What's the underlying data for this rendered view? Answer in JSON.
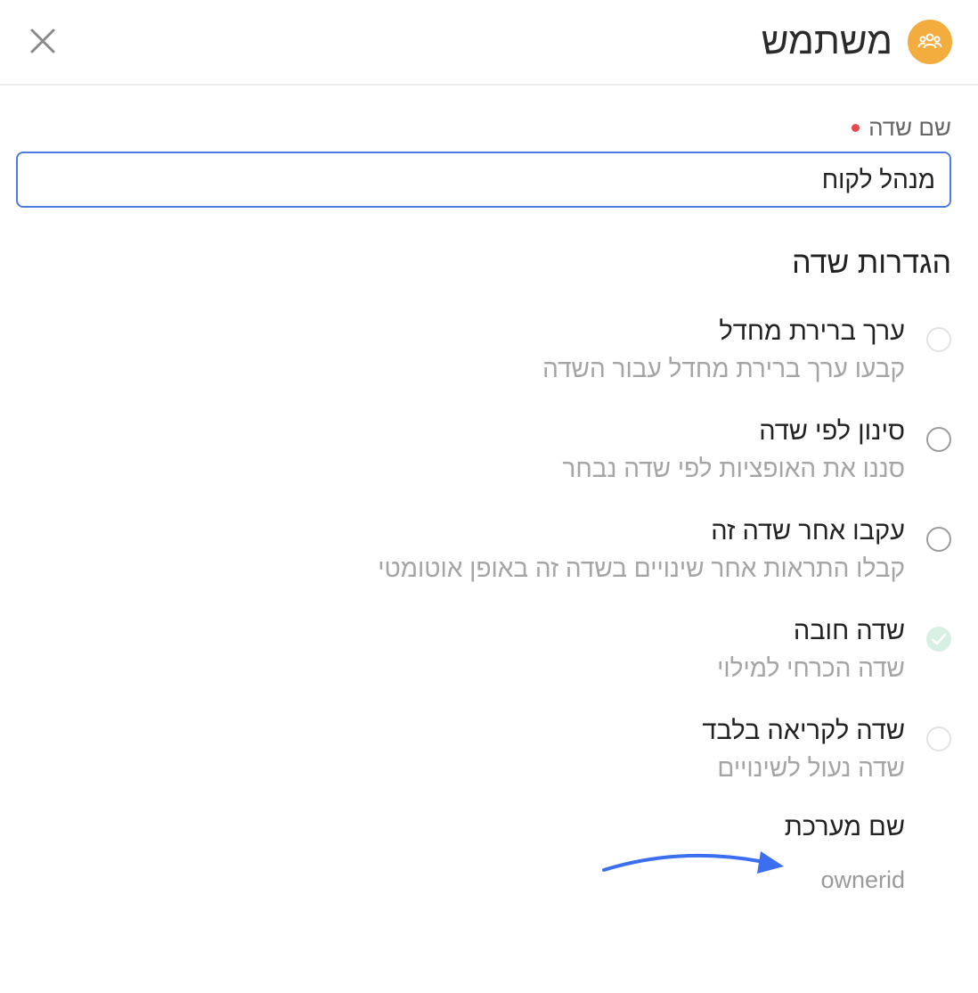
{
  "header": {
    "title": "משתמש",
    "avatar_icon": "users-group-icon",
    "avatar_color": "#f3ad3f",
    "close_icon": "close-icon"
  },
  "field_name": {
    "label": "שם שדה",
    "required": true,
    "value": "מנהל לקוח"
  },
  "settings": {
    "title": "הגדרות שדה",
    "items": [
      {
        "title": "ערך ברירת מחדל",
        "description": "קבעו ערך ברירת מחדל עבור השדה",
        "checked": false
      },
      {
        "title": "סינון לפי שדה",
        "description": "סננו את האופציות לפי שדה נבחר",
        "checked": false
      },
      {
        "title": "עקבו אחר שדה זה",
        "description": "קבלו התראות אחר שינויים בשדה זה באופן אוטומטי",
        "checked": false
      },
      {
        "title": "שדה חובה",
        "description": "שדה הכרחי למילוי",
        "checked": true
      },
      {
        "title": "שדה לקריאה בלבד",
        "description": "שדה נעול לשינויים",
        "checked": false
      }
    ]
  },
  "system_name": {
    "label": "שם מערכת",
    "value": "ownerid"
  },
  "colors": {
    "accent": "#4f7ae0",
    "arrow": "#3b6ff0",
    "checked_bg": "#d8efe3",
    "required_dot": "#e8474d"
  }
}
